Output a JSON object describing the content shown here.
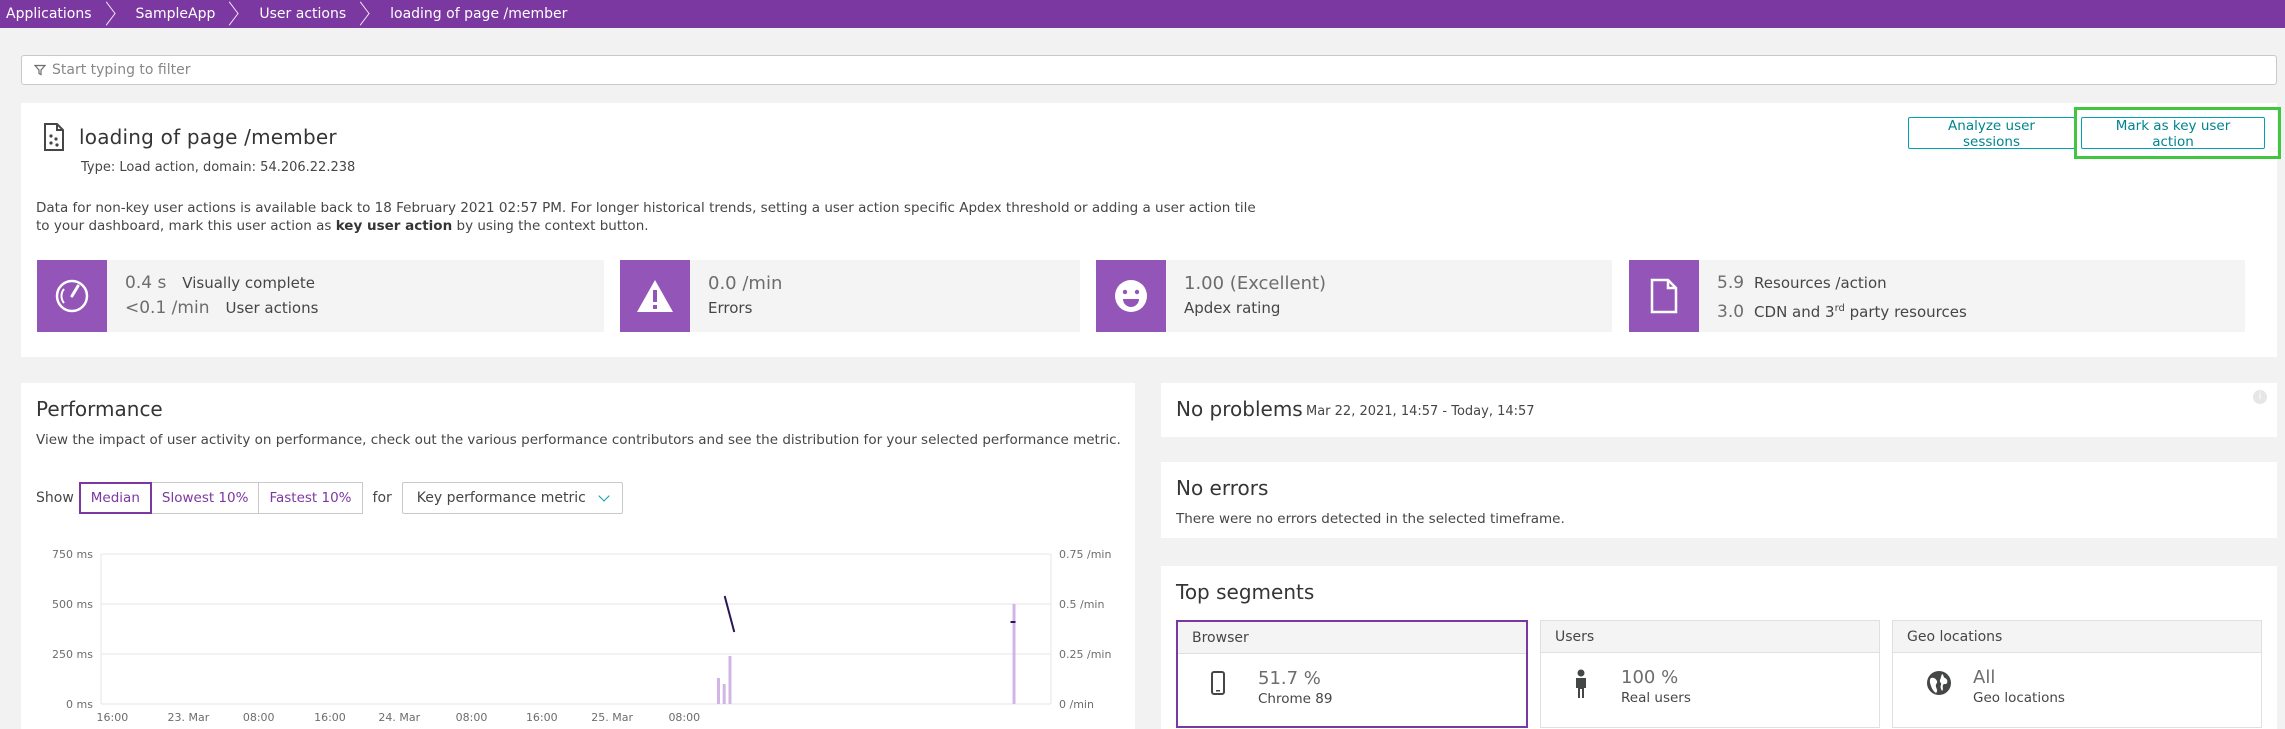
{
  "breadcrumb": [
    "Applications",
    "SampleApp",
    "User actions",
    "loading of page /member"
  ],
  "filter": {
    "placeholder": "Start typing to filter"
  },
  "header": {
    "title": "loading of page /member",
    "subtitle": "Type: Load action, domain: 54.206.22.238",
    "info_part1": "Data for non-key user actions is available back to 18 February 2021 02:57 PM. For longer historical trends, setting a user action specific Apdex threshold or adding a user action tile to your dashboard, mark this user action as ",
    "info_bold": "key user action",
    "info_part2": " by using the context button.",
    "analyze_button": "Analyze user sessions",
    "mark_button": "Mark as key user action"
  },
  "metrics": {
    "m1": {
      "value1": "0.4 s",
      "label1": "Visually complete",
      "value2": "<0.1 /min",
      "label2": "User actions"
    },
    "m2": {
      "value": "0.0 /min",
      "label": "Errors"
    },
    "m3": {
      "value": "1.00 (Excellent)",
      "label": "Apdex rating"
    },
    "m4": {
      "value1": "5.9",
      "label1": "Resources /action",
      "value2": "3.0",
      "label2_pre": "CDN and 3",
      "label2_sup": "rd",
      "label2_post": " party resources"
    }
  },
  "performance": {
    "title": "Performance",
    "description": "View the impact of user activity on performance, check out the various performance contributors and see the distribution for your selected performance metric.",
    "show_label": "Show",
    "segments": [
      "Median",
      "Slowest 10%",
      "Fastest 10%"
    ],
    "active_segment": "Median",
    "for_label": "for",
    "metric_dropdown": "Key performance metric"
  },
  "chart_data": {
    "type": "bar",
    "y_left_ticks": [
      "750 ms",
      "500 ms",
      "250 ms",
      "0 ms"
    ],
    "y_right_ticks": [
      "0.75 /min",
      "0.5 /min",
      "0.25 /min",
      "0 /min"
    ],
    "x_ticks": [
      "16:00",
      "23. Mar",
      "08:00",
      "16:00",
      "24. Mar",
      "08:00",
      "16:00",
      "25. Mar",
      "08:00"
    ],
    "ylim_left_ms": [
      0,
      750
    ],
    "ylim_right_per_min": [
      0,
      0.75
    ],
    "grid": true,
    "line_series_ms": [
      {
        "t": 0.6565,
        "v": 540
      },
      {
        "t": 0.6666,
        "v": 360
      }
    ],
    "line_end_ms": {
      "t": 0.9616,
      "v": 410
    },
    "bars_per_min": [
      {
        "t": 0.6505,
        "v": 0.13
      },
      {
        "t": 0.6565,
        "v": 0.1
      },
      {
        "t": 0.6626,
        "v": 0.24
      },
      {
        "t": 0.9616,
        "v": 0.5
      }
    ],
    "colors": {
      "line": "#2a1559",
      "bar": "#d2b5e4",
      "grid": "#e6e6e6"
    }
  },
  "problems": {
    "title": "No problems",
    "date": "Mar 22, 2021, 14:57 - Today, 14:57"
  },
  "errors": {
    "title": "No errors",
    "description": "There were no errors detected in the selected timeframe."
  },
  "segments": {
    "title": "Top segments",
    "browser": {
      "head": "Browser",
      "value": "51.7 %",
      "sub": "Chrome 89"
    },
    "users": {
      "head": "Users",
      "value": "100 %",
      "sub": "Real users"
    },
    "geo": {
      "head": "Geo locations",
      "value": "All",
      "sub": "Geo locations"
    }
  },
  "colors": {
    "brand": "#7c38a1",
    "icon_tile": "#9355b7",
    "button": "#00a1b2",
    "highlight": "#40c640"
  }
}
